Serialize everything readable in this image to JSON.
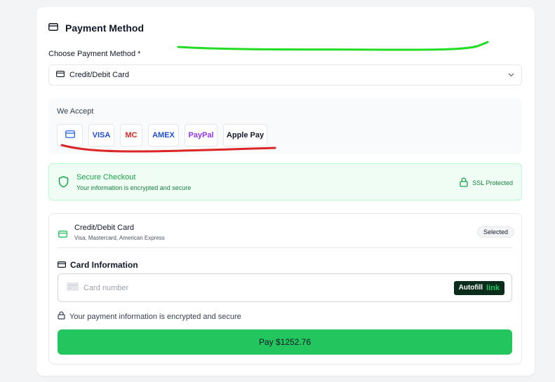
{
  "header": {
    "title": "Payment Method",
    "icon": "credit-card-icon"
  },
  "choose": {
    "label": "Choose Payment Method *",
    "selected_value": "Credit/Debit Card"
  },
  "accept": {
    "label": "We Accept",
    "badges": [
      {
        "text": "",
        "icon": "credit-card-icon",
        "color": "#2563eb"
      },
      {
        "text": "VISA",
        "color": "#1d4ed8"
      },
      {
        "text": "MC",
        "color": "#dc2626"
      },
      {
        "text": "AMEX",
        "color": "#1d4ed8"
      },
      {
        "text": "PayPal",
        "color": "#9333ea"
      },
      {
        "text": "Apple Pay",
        "color": "#111827"
      }
    ]
  },
  "secure": {
    "title": "Secure Checkout",
    "subtitle": "Your information is encrypted and secure",
    "ssl_label": "SSL Protected"
  },
  "card_option": {
    "title": "Credit/Debit Card",
    "subtitle": "Visa, Mastercard, American Express",
    "badge": "Selected"
  },
  "card_info": {
    "title": "Card Information",
    "placeholder": "Card number",
    "autofill_label": "Autofill",
    "autofill_link": "link",
    "encrypted_note": "Your payment information is encrypted and secure"
  },
  "pay_button": {
    "label": "Pay $1252.76"
  },
  "colors": {
    "accent_green": "#22c55e",
    "annotation_green": "#22dd22",
    "annotation_red": "#dc2626"
  }
}
